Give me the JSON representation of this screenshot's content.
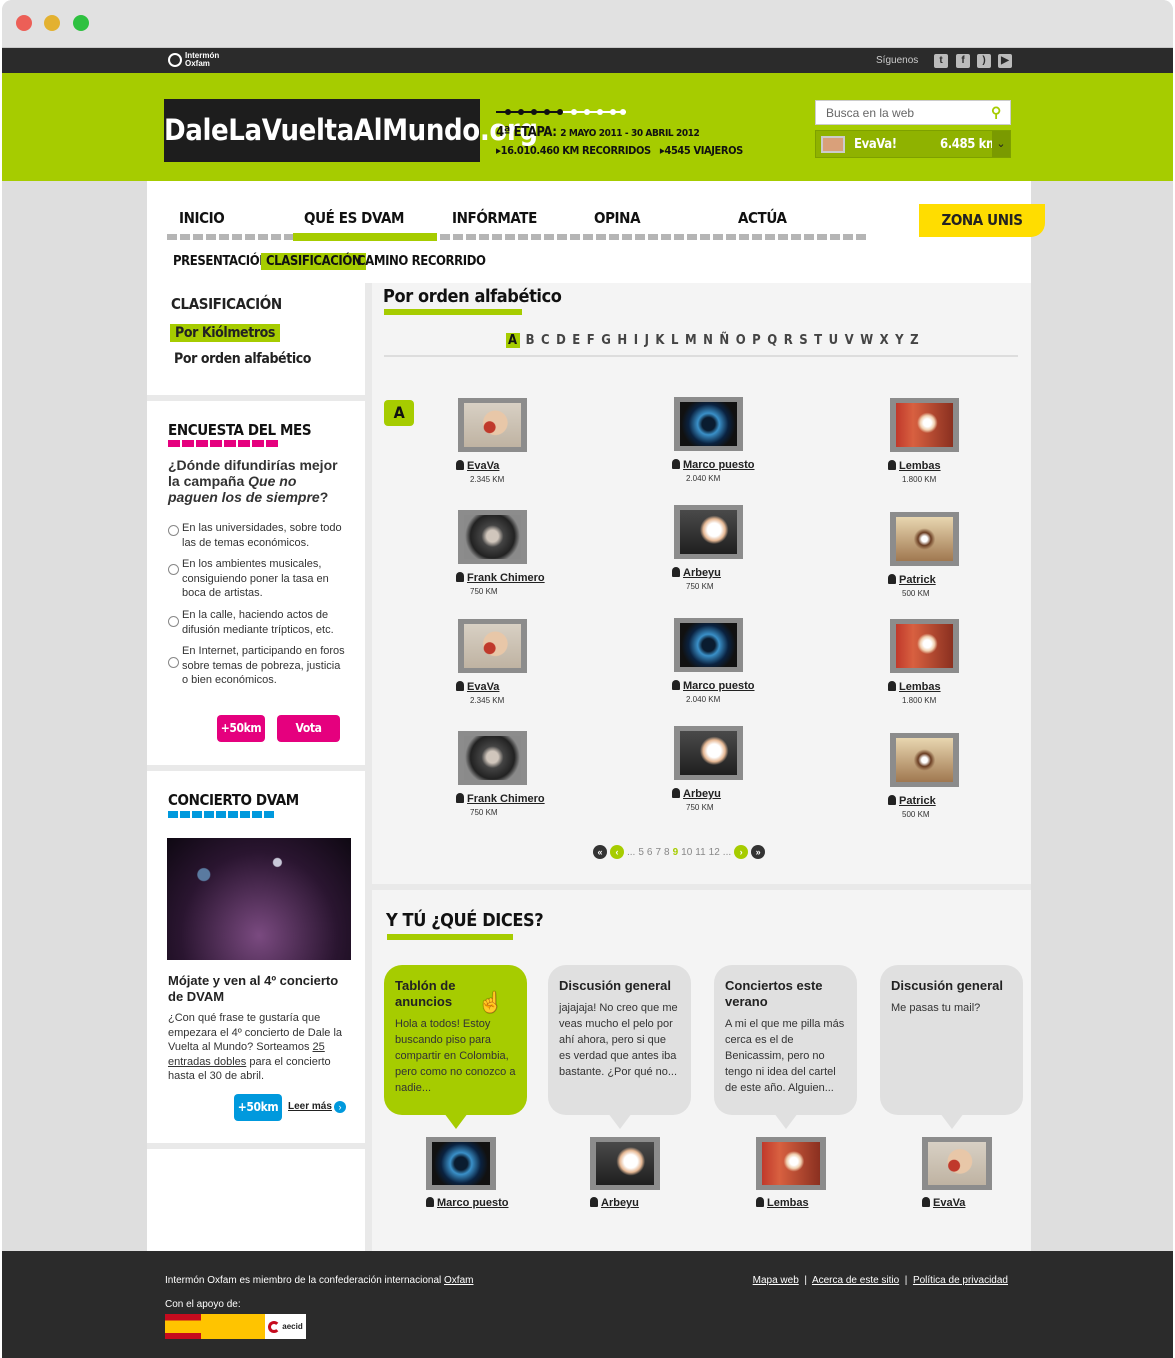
{
  "window": {
    "dots": [
      "#ec5f57",
      "#e3b130",
      "#2ec140"
    ]
  },
  "topbar": {
    "logo_line1": "Intermón",
    "logo_line2": "Oxfam",
    "follow_label": "Síguenos",
    "social_icons": [
      "twitter-icon",
      "facebook-icon",
      "rss-icon",
      "youtube-icon"
    ]
  },
  "header": {
    "site_name": "DaleLaVueltaAlMundo.org",
    "stage_title": "4ª ETAPA:",
    "stage_dates": "2 MAYO 2011 - 30 ABRIL 2012",
    "km_total": "16.010.460 KM RECORRIDOS",
    "travellers": "4545 VIAJEROS",
    "search_placeholder": "Busca en la web",
    "user_name": "EvaVa!",
    "user_km": "6.485 km"
  },
  "nav": {
    "items": [
      "INICIO",
      "QUÉ ES DVAM",
      "INFÓRMATE",
      "OPINA",
      "ACTÚA"
    ],
    "zona": "ZONA UNIS",
    "sub": [
      "PRESENTACIÓN",
      "CLASIFICACIÓN",
      "CAMINO RECORRIDO"
    ]
  },
  "sidebar": {
    "clasif_title": "CLASIFICACIÓN",
    "by_km": "Por Kiólmetros",
    "by_alpha": "Por orden alfabético",
    "poll_title": "ENCUESTA DEL MES",
    "poll_q_a": "¿Dónde difundirías mejor la campaña ",
    "poll_q_em": "Que no paguen los de siempre",
    "poll_q_b": "?",
    "poll_options": [
      "En las universidades, sobre todo las de temas económicos.",
      "En los ambientes musicales, consiguiendo poner la tasa en boca de artistas.",
      "En la calle, haciendo actos de difusión mediante trípticos, etc.",
      "En Internet, participando en foros sobre temas de pobreza, justicia o bien económicos."
    ],
    "poll_km": "+50km",
    "poll_vote": "Vota",
    "concert_title": "CONCIERTO DVAM",
    "concert_heading": "Mójate y ven al 4º concierto de DVAM",
    "concert_text_a": "¿Con qué frase te gustaría que empezara el 4º concierto de Dale la Vuelta al Mundo? Sorteamos ",
    "concert_text_link": "25 entradas dobles",
    "concert_text_b": " para el concierto hasta el 30 de abril.",
    "concert_km": "+50km",
    "read_more": "Leer más"
  },
  "ranking": {
    "title": "Por orden alfabético",
    "letters": [
      "A",
      "B",
      "C",
      "D",
      "E",
      "F",
      "G",
      "H",
      "I",
      "J",
      "K",
      "L",
      "M",
      "N",
      "Ñ",
      "O",
      "P",
      "Q",
      "R",
      "S",
      "T",
      "U",
      "V",
      "W",
      "X",
      "Y",
      "Z"
    ],
    "active_letter": "A",
    "badge": "A",
    "users": [
      {
        "name": "EvaVa",
        "km": "2.345 KM",
        "photo": "girl"
      },
      {
        "name": "Marco puesto",
        "km": "2.040 KM",
        "photo": "ojo"
      },
      {
        "name": "Lembas",
        "km": "1.800 KM",
        "photo": "lem"
      },
      {
        "name": "Frank Chimero",
        "km": "750 KM",
        "photo": "hood"
      },
      {
        "name": "Arbeyu",
        "km": "750 KM",
        "photo": "arb"
      },
      {
        "name": "Patrick",
        "km": "500 KM",
        "photo": "pat"
      },
      {
        "name": "EvaVa",
        "km": "2.345 KM",
        "photo": "girl"
      },
      {
        "name": "Marco puesto",
        "km": "2.040 KM",
        "photo": "ojo"
      },
      {
        "name": "Lembas",
        "km": "1.800 KM",
        "photo": "lem"
      },
      {
        "name": "Frank Chimero",
        "km": "750 KM",
        "photo": "hood"
      },
      {
        "name": "Arbeyu",
        "km": "750 KM",
        "photo": "arb"
      },
      {
        "name": "Patrick",
        "km": "500 KM",
        "photo": "pat"
      }
    ],
    "pager_prefix": "...",
    "pages": [
      "5",
      "6",
      "7",
      "8",
      "9",
      "10",
      "11",
      "12"
    ],
    "current_page": "9",
    "pager_suffix": "..."
  },
  "comments": {
    "title": "Y TÚ ¿QUÉ DICES?",
    "items": [
      {
        "title": "Tablón de anuncios",
        "text": "Hola a todos! Estoy buscando piso para compartir en Colombia, pero como no conozco a nadie...",
        "author": "Marco puesto",
        "photo": "ojo"
      },
      {
        "title": "Discusión general",
        "text": "jajajaja! No creo que me veas mucho el pelo por ahí ahora, pero si que es verdad que antes iba bastante. ¿Por qué no...",
        "author": "Arbeyu",
        "photo": "arb"
      },
      {
        "title": "Conciertos este verano",
        "text": "A mi el que me pilla más cerca es el de Benicassim, pero no tengo ni idea del cartel de este año. Alguien...",
        "author": "Lembas",
        "photo": "lem"
      },
      {
        "title": "Discusión general",
        "text": "Me pasas tu mail?",
        "author": "EvaVa",
        "photo": "girl"
      }
    ]
  },
  "footer": {
    "member_text": "Intermón Oxfam es miembro de la confederación internacional ",
    "member_link": "Oxfam",
    "links": [
      "Mapa web",
      "Acerca de este sitio",
      "Política de privacidad"
    ],
    "support": "Con el apoyo de:",
    "logo_text": "aecid"
  }
}
